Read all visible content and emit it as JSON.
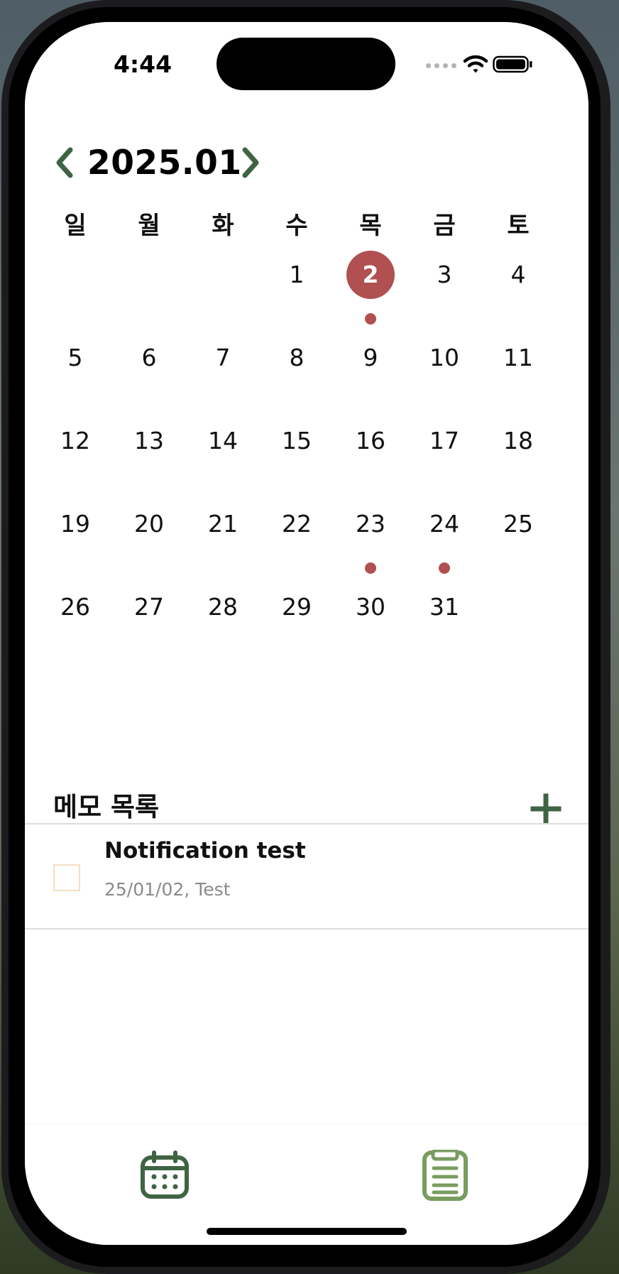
{
  "status_bar": {
    "time": "4:44"
  },
  "header": {
    "month_label": "2025.01"
  },
  "weekdays": [
    "일",
    "월",
    "화",
    "수",
    "목",
    "금",
    "토"
  ],
  "calendar": {
    "weeks": [
      [
        {
          "day": ""
        },
        {
          "day": ""
        },
        {
          "day": ""
        },
        {
          "day": "1"
        },
        {
          "day": "2",
          "selected": true,
          "has_memo": true
        },
        {
          "day": "3"
        },
        {
          "day": "4"
        }
      ],
      [
        {
          "day": "5"
        },
        {
          "day": "6"
        },
        {
          "day": "7"
        },
        {
          "day": "8"
        },
        {
          "day": "9"
        },
        {
          "day": "10"
        },
        {
          "day": "11"
        }
      ],
      [
        {
          "day": "12"
        },
        {
          "day": "13"
        },
        {
          "day": "14"
        },
        {
          "day": "15"
        },
        {
          "day": "16"
        },
        {
          "day": "17"
        },
        {
          "day": "18"
        }
      ],
      [
        {
          "day": "19"
        },
        {
          "day": "20"
        },
        {
          "day": "21"
        },
        {
          "day": "22"
        },
        {
          "day": "23",
          "has_memo": true
        },
        {
          "day": "24",
          "has_memo": true
        },
        {
          "day": "25"
        }
      ],
      [
        {
          "day": "26"
        },
        {
          "day": "27"
        },
        {
          "day": "28"
        },
        {
          "day": "29"
        },
        {
          "day": "30"
        },
        {
          "day": "31"
        },
        {
          "day": ""
        }
      ]
    ]
  },
  "memo_list": {
    "title": "메모 목록",
    "items": [
      {
        "title": "Notification test",
        "subtitle": "25/01/02, Test",
        "checked": false
      }
    ]
  },
  "tabbar": {
    "tabs": [
      {
        "icon": "calendar-icon"
      },
      {
        "icon": "clipboard-list-icon"
      }
    ]
  },
  "colors": {
    "accent_green": "#3f6443",
    "light_green": "#7a9c5f",
    "selected_red": "#b05050",
    "checkbox_border": "#f1dfc4",
    "subtitle_gray": "#8a8a8a"
  }
}
